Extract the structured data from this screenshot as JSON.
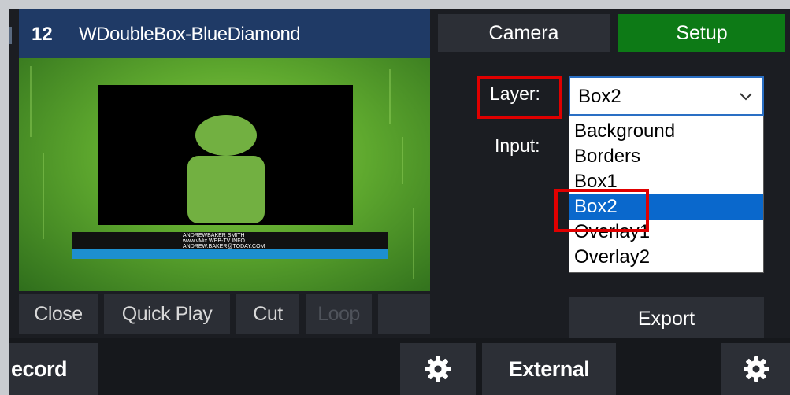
{
  "preview": {
    "number": "12",
    "title": "WDoubleBox-BlueDiamond",
    "lower_third_line1": "ANDREWBAKER SMITH",
    "lower_third_line2": "www.vMix WEB-TV INFO",
    "lower_third_line3": "ANDREW.BAKER@TODAY.COM"
  },
  "transport": {
    "close": "Close",
    "quick_play": "Quick Play",
    "cut": "Cut",
    "loop": "Loop"
  },
  "tabs": {
    "camera": "Camera",
    "setup": "Setup"
  },
  "setup": {
    "layer_label": "Layer:",
    "input_label": "Input:",
    "layer_value": "Box2",
    "layer_options": [
      "Background",
      "Borders",
      "Box1",
      "Box2",
      "Overlay1",
      "Overlay2"
    ],
    "export_label": "Export"
  },
  "bottom": {
    "record_label": "ecord",
    "external_label": "External"
  },
  "colors": {
    "setup_tab": "#0d7a16",
    "header_blue": "#1f3a66",
    "highlight_red": "#e00000",
    "selection_blue": "#0a68cc"
  },
  "icons": [
    "chevron-down-icon",
    "gear-icon"
  ]
}
